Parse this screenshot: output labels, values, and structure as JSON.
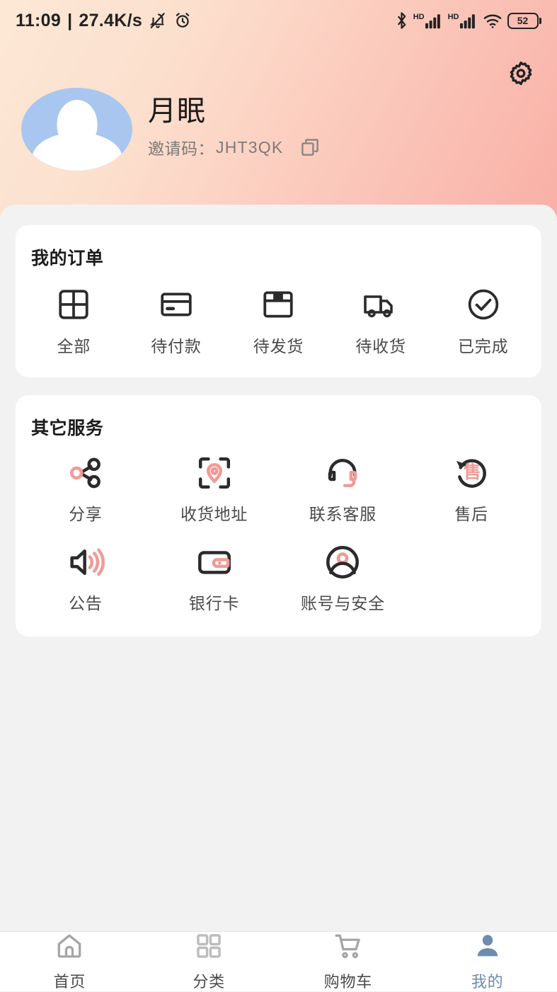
{
  "statusbar": {
    "time": "11:09",
    "separator": "|",
    "network_speed": "27.4K/s",
    "mute_icon": "bell-muted-icon",
    "alarm_icon": "alarm-clock-icon",
    "bluetooth_icon": "bluetooth-icon",
    "hd_label_1": "HD",
    "hd_label_2": "HD",
    "signal_icon_1": "cellular-signal-icon",
    "signal_icon_2": "cellular-signal-icon",
    "wifi_icon": "wifi-icon",
    "battery_level": "52"
  },
  "header": {
    "settings_icon": "gear-icon",
    "avatar_icon": "avatar-placeholder",
    "username": "月眠",
    "invite_label": "邀请码：",
    "invite_code": "JHT3QK",
    "copy_icon": "copy-icon",
    "gradient_start": "#FDE8D6",
    "gradient_end": "#F9AFA6",
    "avatar_color": "#A8C6F0"
  },
  "orders": {
    "title": "我的订单",
    "items": [
      {
        "label": "全部",
        "icon": "grid-squares-icon"
      },
      {
        "label": "待付款",
        "icon": "credit-card-icon"
      },
      {
        "label": "待发货",
        "icon": "package-box-icon"
      },
      {
        "label": "待收货",
        "icon": "delivery-truck-icon"
      },
      {
        "label": "已完成",
        "icon": "check-circle-icon"
      }
    ]
  },
  "services": {
    "title": "其它服务",
    "accent_color": "#F09B97",
    "items": [
      {
        "label": "分享",
        "icon": "share-nodes-icon"
      },
      {
        "label": "收货地址",
        "icon": "location-pin-scan-icon"
      },
      {
        "label": "联系客服",
        "icon": "headset-support-icon"
      },
      {
        "label": "售后",
        "icon": "after-sales-return-icon",
        "glyph": "售"
      },
      {
        "label": "公告",
        "icon": "speaker-announcement-icon"
      },
      {
        "label": "银行卡",
        "icon": "wallet-bankcard-icon"
      },
      {
        "label": "账号与安全",
        "icon": "account-security-icon"
      }
    ]
  },
  "bottomnav": {
    "active_color": "#6E8CAE",
    "inactive_color": "#9E9E9E",
    "items": [
      {
        "label": "首页",
        "icon": "home-icon",
        "active": false
      },
      {
        "label": "分类",
        "icon": "grid-icon",
        "active": false
      },
      {
        "label": "购物车",
        "icon": "cart-icon",
        "active": false
      },
      {
        "label": "我的",
        "icon": "person-icon",
        "active": true
      }
    ]
  }
}
